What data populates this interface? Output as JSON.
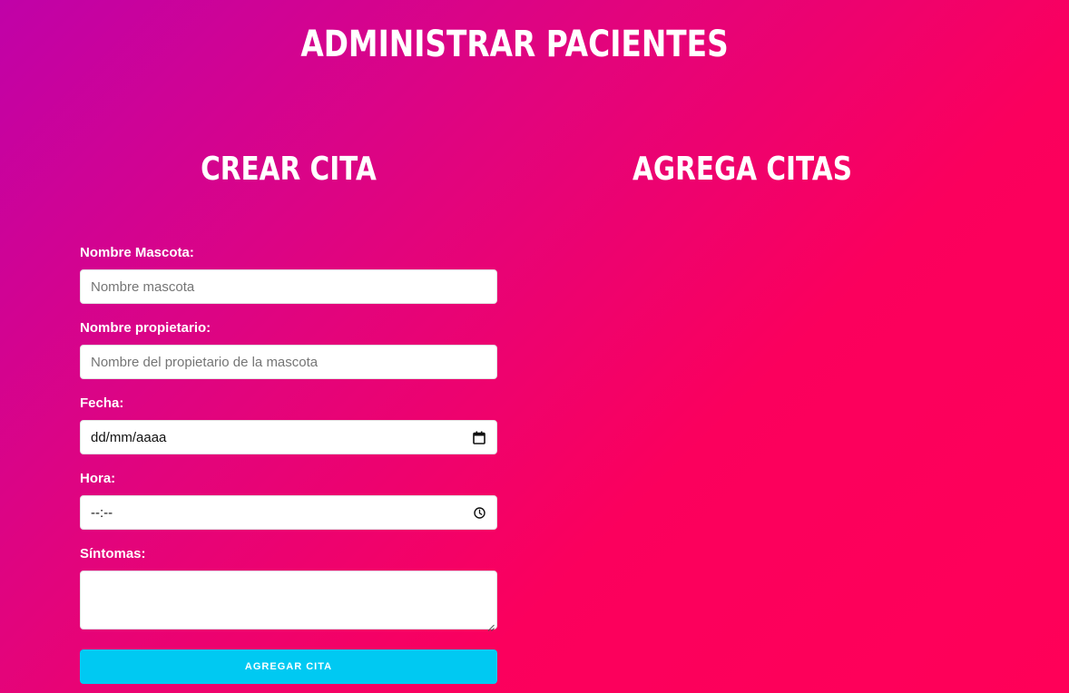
{
  "header": {
    "title": "ADMINISTRAR PACIENTES"
  },
  "left_column": {
    "title": "CREAR CITA"
  },
  "right_column": {
    "title": "AGREGA CITAS"
  },
  "form": {
    "pet_name": {
      "label": "Nombre Mascota:",
      "placeholder": "Nombre mascota"
    },
    "owner_name": {
      "label": "Nombre propietario:",
      "placeholder": "Nombre del propietario de la mascota"
    },
    "date": {
      "label": "Fecha:",
      "value": "dd/mm/aaaa",
      "icon": "calendar-icon"
    },
    "time": {
      "label": "Hora:",
      "value": "--:--",
      "icon": "clock-icon"
    },
    "symptoms": {
      "label": "Síntomas:",
      "value": ""
    },
    "submit_label": "AGREGAR CITA"
  },
  "colors": {
    "gradient_start": "#c002a8",
    "gradient_end": "#ff0058",
    "button": "#00c9f2",
    "text": "#ffffff"
  }
}
